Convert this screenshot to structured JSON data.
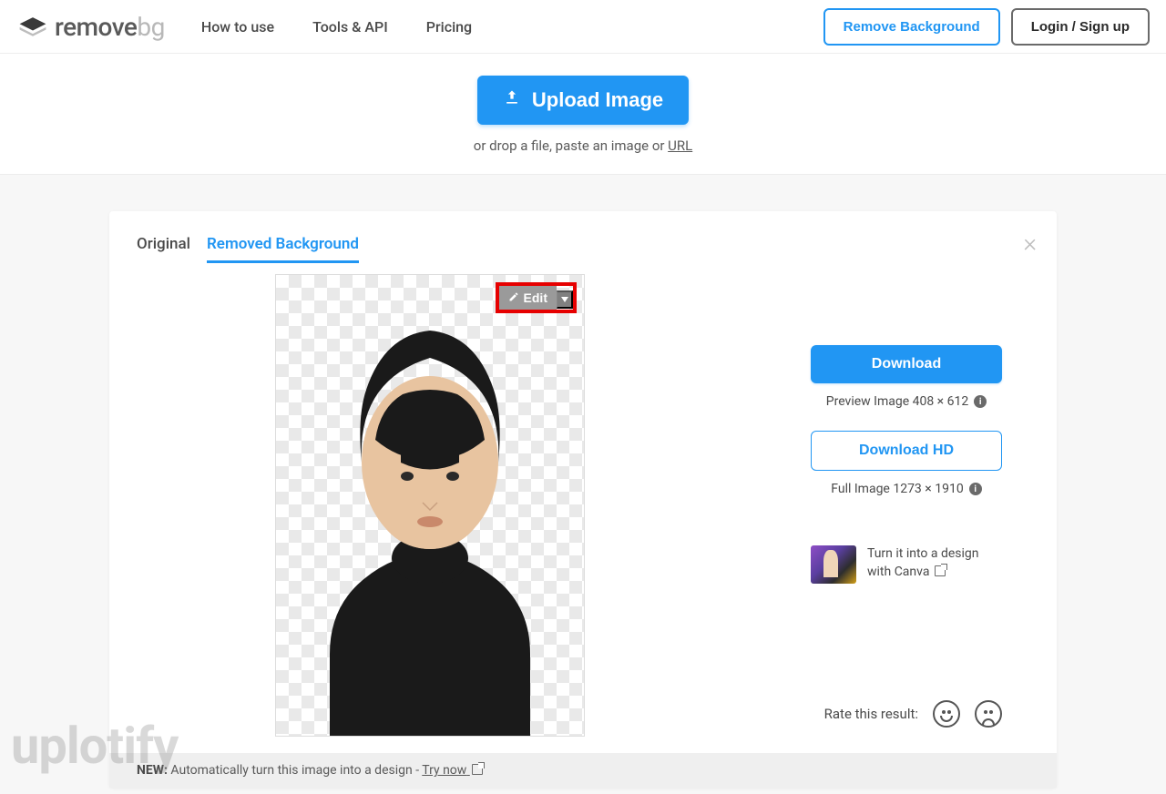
{
  "header": {
    "logo_text_a": "remove",
    "logo_text_b": "bg",
    "nav": {
      "how": "How to use",
      "tools": "Tools & API",
      "pricing": "Pricing"
    },
    "remove_bg": "Remove Background",
    "login": "Login / Sign up"
  },
  "upload": {
    "button": "Upload Image",
    "drop_prefix": "or drop a file, paste an image or ",
    "url_link": "URL"
  },
  "tabs": {
    "original": "Original",
    "removed": "Removed Background"
  },
  "edit": {
    "label": "Edit"
  },
  "download": {
    "standard": "Download",
    "preview_meta": "Preview Image 408 × 612",
    "hd": "Download HD",
    "full_meta": "Full Image 1273 × 1910"
  },
  "canva": {
    "line1": "Turn it into a design",
    "line2": "with Canva"
  },
  "rate": {
    "label": "Rate this result:"
  },
  "footer": {
    "new_tag": "NEW:",
    "text": " Automatically turn this image into a design - ",
    "try_now": "Try now"
  },
  "watermark": "uplotify",
  "colors": {
    "accent": "#2196f3",
    "highlight_border": "#e60000"
  }
}
